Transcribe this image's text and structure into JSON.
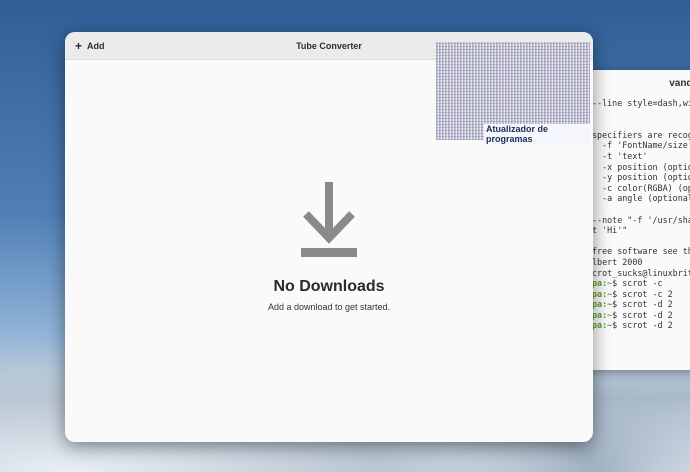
{
  "app": {
    "title": "Tube Converter",
    "add_label": "Add",
    "empty_title": "No Downloads",
    "empty_subtitle": "Add a download to get started."
  },
  "overlay": {
    "label": "Atualizador de programas"
  },
  "terminal": {
    "title": "vander",
    "lines": [
      "--line style=dash,wid",
      "",
      "",
      "specifiers are recogn",
      "  -f 'FontName/size'",
      "  -t 'text'",
      "  -x position (option",
      "  -y position (option",
      "  -c color(RGBA) (opt",
      "  -a angle (optional)",
      "",
      "--note \"-f '/usr/shar",
      "t 'Hi'\"",
      "",
      "free software see the",
      "lbert 2000",
      "crot_sucks@linuxbrit.",
      "pa:~$ scrot -c",
      "pa:~$ scrot -c 2",
      "pa:~$ scrot -d 2",
      "pa:~$ scrot -d 2",
      "pa:~$ scrot -d 2"
    ]
  },
  "icons": {
    "add": "plus-icon",
    "download": "download-arrow-icon"
  },
  "colors": {
    "window_bg": "#fafafa",
    "header_bg": "#ebebeb",
    "icon_gray": "#8a8a8a",
    "prompt_green": "#5b9e2b"
  }
}
